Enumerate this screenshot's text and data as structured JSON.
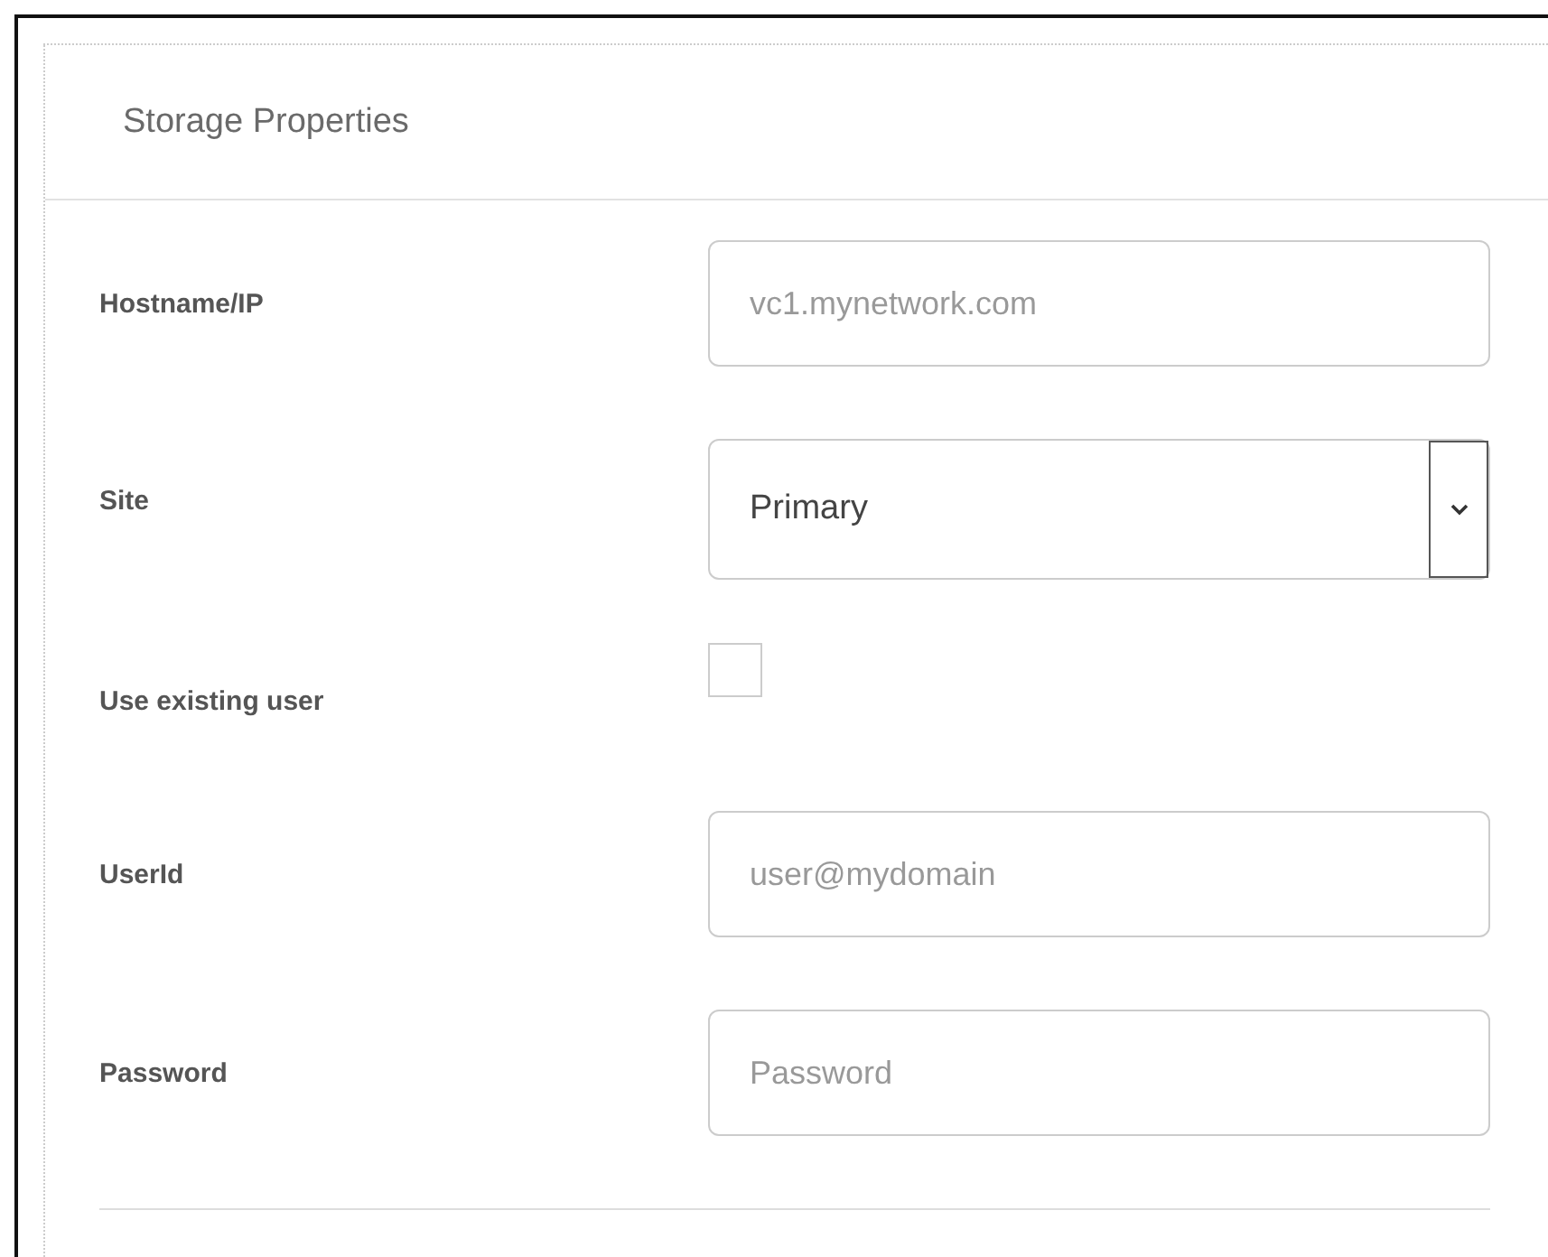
{
  "panel": {
    "title": "Storage Properties"
  },
  "fields": [
    {
      "kind": "text",
      "label": "Hostname/IP",
      "placeholder": "vc1.mynetwork.com"
    },
    {
      "kind": "select",
      "label": "Site",
      "value": "Primary"
    },
    {
      "kind": "checkbox",
      "label": "Use existing user",
      "checked": false
    },
    {
      "kind": "text",
      "label": "UserId",
      "placeholder": "user@mydomain"
    },
    {
      "kind": "password",
      "label": "Password",
      "placeholder": "Password"
    }
  ]
}
